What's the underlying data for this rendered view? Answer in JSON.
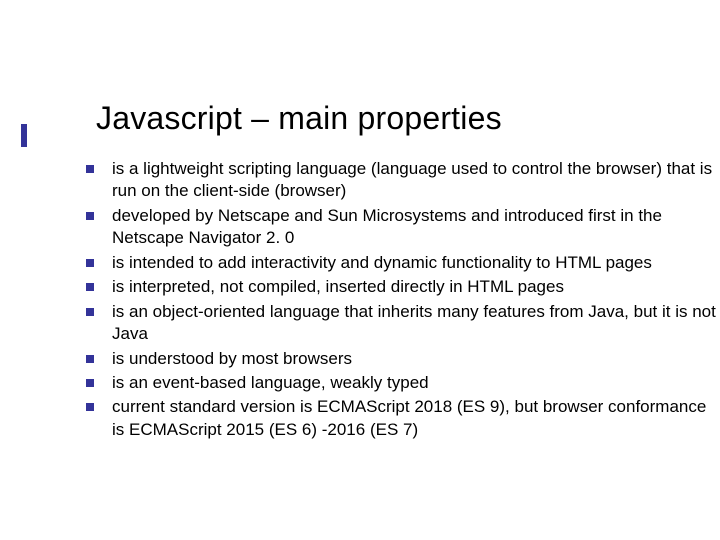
{
  "title": "Javascript – main properties",
  "bullets": [
    "is a lightweight scripting language (language used to control the browser) that is run on the client-side (browser)",
    "developed by Netscape and Sun Microsystems and introduced first in the Netscape Navigator 2. 0",
    "is intended to add interactivity and dynamic functionality to HTML pages",
    "is interpreted, not compiled, inserted directly in HTML pages",
    "is an object-oriented language that inherits many features from Java, but it is not Java",
    "is understood by most browsers",
    "is an event-based language, weakly typed",
    "current standard version is ECMAScript 2018 (ES 9), but browser conformance is ECMAScript 2015 (ES 6) -2016 (ES 7)"
  ]
}
